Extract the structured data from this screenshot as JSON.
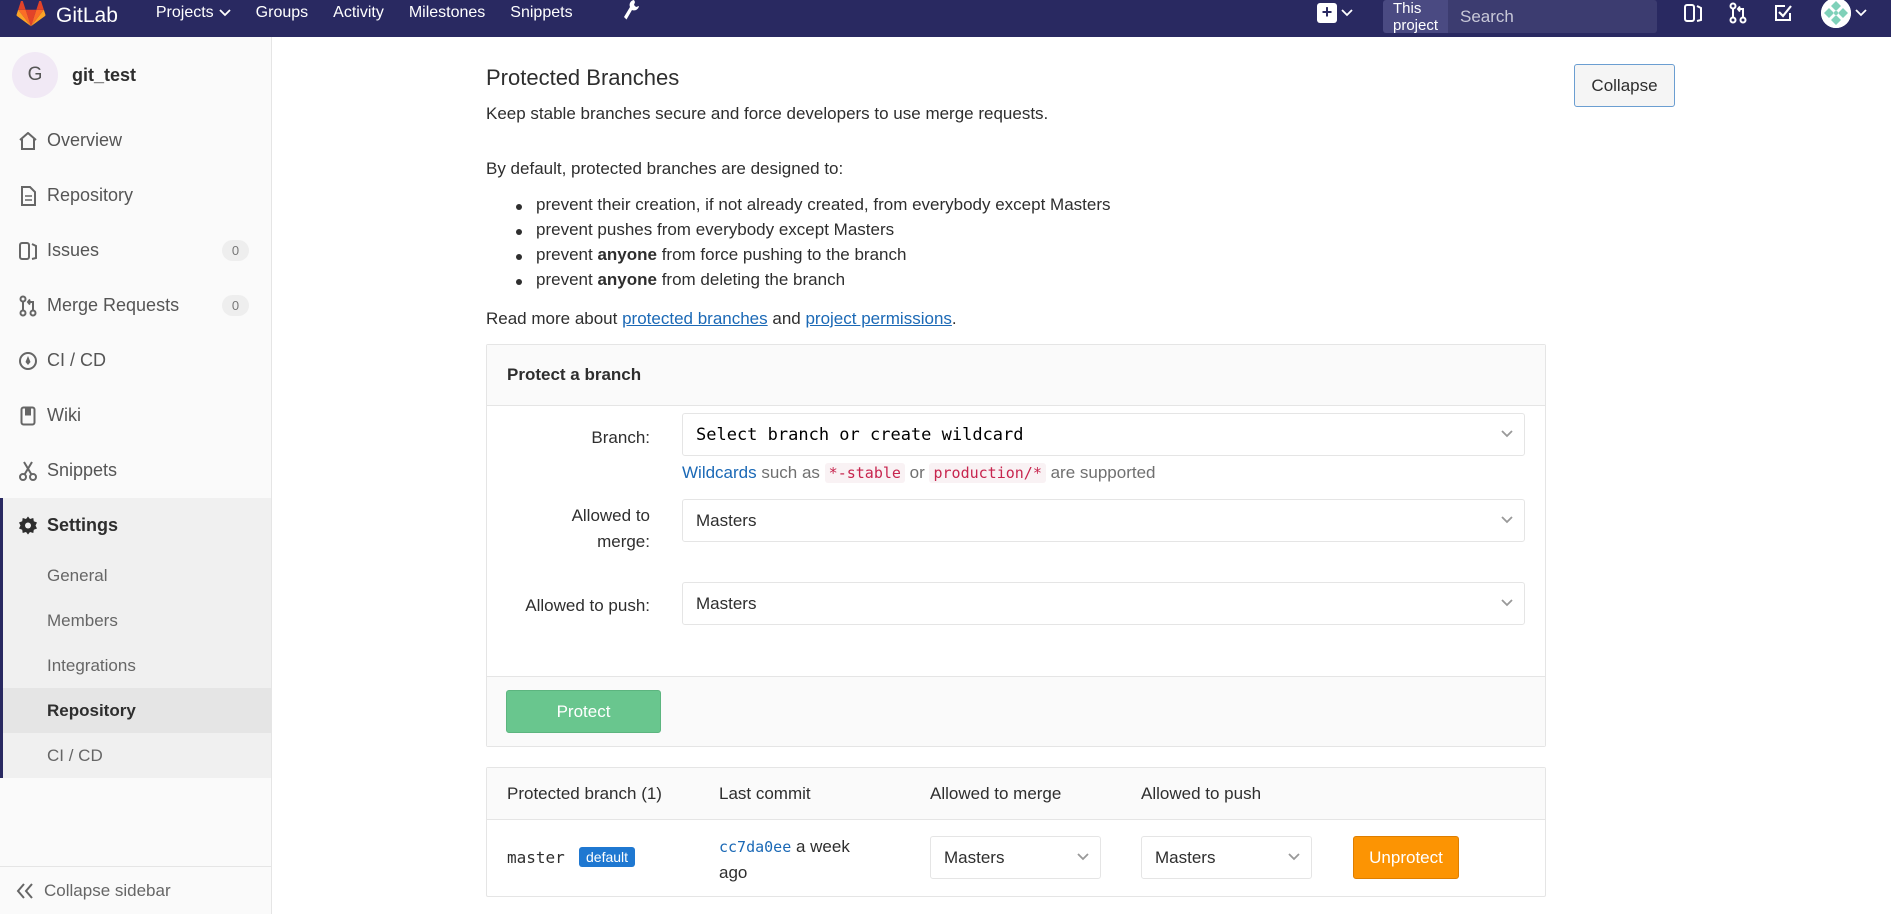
{
  "navbar": {
    "brand": "GitLab",
    "links": [
      "Projects",
      "Groups",
      "Activity",
      "Milestones",
      "Snippets"
    ],
    "search_scope": "This project",
    "search_placeholder": "Search"
  },
  "sidebar": {
    "project_initial": "G",
    "project_name": "git_test",
    "items": [
      {
        "label": "Overview"
      },
      {
        "label": "Repository"
      },
      {
        "label": "Issues",
        "count": "0"
      },
      {
        "label": "Merge Requests",
        "count": "0"
      },
      {
        "label": "CI / CD"
      },
      {
        "label": "Wiki"
      },
      {
        "label": "Snippets"
      }
    ],
    "settings": {
      "label": "Settings",
      "subitems": [
        "General",
        "Members",
        "Integrations",
        "Repository",
        "CI / CD"
      ]
    },
    "collapse_label": "Collapse sidebar"
  },
  "main": {
    "title": "Protected Branches",
    "subtitle": "Keep stable branches secure and force developers to use merge requests.",
    "collapse_label": "Collapse",
    "intro": "By default, protected branches are designed to:",
    "rules": [
      {
        "pre": "prevent their creation, if not already created, from everybody except Masters",
        "bold": "",
        "post": ""
      },
      {
        "pre": "prevent pushes from everybody except Masters",
        "bold": "",
        "post": ""
      },
      {
        "pre": "prevent ",
        "bold": "anyone",
        "post": " from force pushing to the branch"
      },
      {
        "pre": "prevent ",
        "bold": "anyone",
        "post": " from deleting the branch"
      }
    ],
    "readmore": {
      "pre": "Read more about ",
      "link1": "protected branches",
      "mid": " and ",
      "link2": "project permissions",
      "post": "."
    },
    "protect_panel": {
      "heading": "Protect a branch",
      "branch_label": "Branch:",
      "branch_placeholder": "Select branch or create wildcard",
      "help": {
        "link": "Wildcards",
        "t1": " such as ",
        "code1": "*-stable",
        "t2": " or ",
        "code2": "production/*",
        "t3": " are supported"
      },
      "merge_label_line1": "Allowed to",
      "merge_label_line2": "merge:",
      "merge_value": "Masters",
      "push_label": "Allowed to push:",
      "push_value": "Masters",
      "protect_button": "Protect"
    },
    "table": {
      "headers": [
        "Protected branch (1)",
        "Last commit",
        "Allowed to merge",
        "Allowed to push"
      ],
      "row": {
        "branch": "master",
        "badge": "default",
        "sha": "cc7da0ee",
        "commit_time": " a week ago",
        "merge": "Masters",
        "push": "Masters",
        "unprotect_button": "Unprotect"
      }
    }
  }
}
